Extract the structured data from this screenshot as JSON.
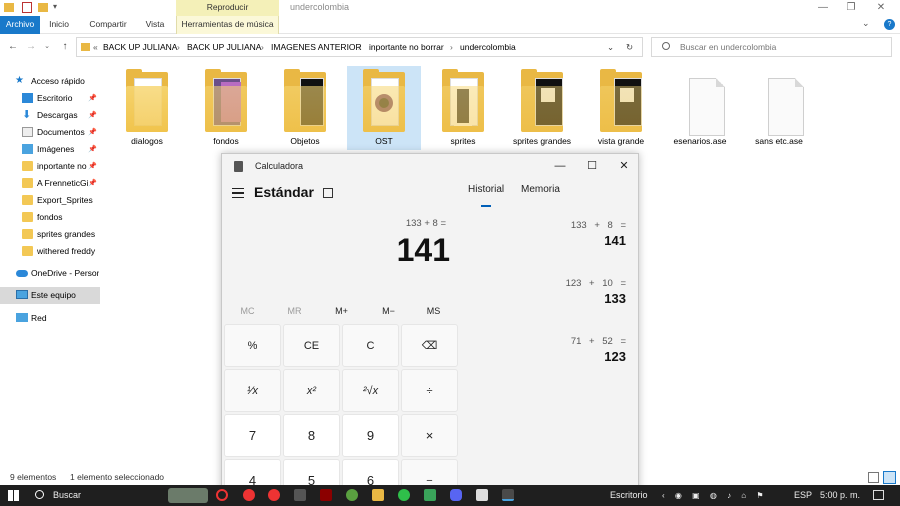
{
  "explorer": {
    "title": "undercolombia",
    "context_tab_header": "Reproducir",
    "ribbon_tabs": [
      "Archivo",
      "Inicio",
      "Compartir",
      "Vista",
      "Herramientas de música"
    ],
    "breadcrumb": [
      "BACK UP JULIANA",
      "BACK UP JULIANA",
      "IMAGENES ANTERIOR",
      "inportante no borrar",
      "undercolombia"
    ],
    "breadcrumb_prefix": "«",
    "search_placeholder": "Buscar en undercolombia",
    "sidebar": [
      {
        "label": "Acceso rápido",
        "icon": "star-icon"
      },
      {
        "label": "Escritorio",
        "icon": "desktop-folder-icon",
        "pinned": true
      },
      {
        "label": "Descargas",
        "icon": "download-folder-icon",
        "pinned": true
      },
      {
        "label": "Documentos",
        "icon": "documents-folder-icon",
        "pinned": true
      },
      {
        "label": "Imágenes",
        "icon": "pictures-folder-icon",
        "pinned": true
      },
      {
        "label": "inportante no",
        "icon": "folder-icon",
        "pinned": true
      },
      {
        "label": "A FrenneticGi",
        "icon": "folder-icon",
        "pinned": true
      },
      {
        "label": "Export_Sprites",
        "icon": "folder-icon"
      },
      {
        "label": "fondos",
        "icon": "folder-icon"
      },
      {
        "label": "sprites grandes",
        "icon": "folder-icon"
      },
      {
        "label": "withered freddy",
        "icon": "folder-icon"
      },
      {
        "label": "OneDrive - Person",
        "icon": "cloud-icon"
      },
      {
        "label": "Este equipo",
        "icon": "computer-icon",
        "selected": true
      },
      {
        "label": "Red",
        "icon": "network-icon"
      }
    ],
    "files": [
      {
        "label": "dialogos",
        "type": "folder",
        "preview": "blank"
      },
      {
        "label": "fondos",
        "type": "folder",
        "preview": "purple"
      },
      {
        "label": "Objetos",
        "type": "folder",
        "preview": "dark"
      },
      {
        "label": "OST",
        "type": "folder",
        "preview": "disc",
        "selected": true
      },
      {
        "label": "sprites",
        "type": "folder",
        "preview": "sprite"
      },
      {
        "label": "sprites grandes",
        "type": "folder",
        "preview": "bigsprite"
      },
      {
        "label": "vista grande",
        "type": "folder",
        "preview": "bigsprite"
      },
      {
        "label": "esenarios.ase",
        "type": "file"
      },
      {
        "label": "sans etc.ase",
        "type": "file"
      }
    ],
    "status": {
      "items": "9 elementos",
      "selected": "1 elemento seleccionado"
    }
  },
  "calculator": {
    "title": "Calculadora",
    "mode": "Estándar",
    "expression": "133 + 8 =",
    "result": "141",
    "memory_buttons": [
      {
        "label": "MC",
        "enabled": false
      },
      {
        "label": "MR",
        "enabled": false
      },
      {
        "label": "M+",
        "enabled": true
      },
      {
        "label": "M−",
        "enabled": true
      },
      {
        "label": "MS",
        "enabled": true
      }
    ],
    "keys": [
      [
        "%",
        "CE",
        "C",
        "⌫"
      ],
      [
        "¹⁄x",
        "x²",
        "²√x",
        "÷"
      ],
      [
        "7",
        "8",
        "9",
        "×"
      ],
      [
        "4",
        "5",
        "6",
        "−"
      ]
    ],
    "history_tabs": [
      "Historial",
      "Memoria"
    ],
    "history": [
      {
        "expression": "133   +   8   =",
        "result": "141"
      },
      {
        "expression": "123   +   10   =",
        "result": "133"
      },
      {
        "expression": "71   +   52   =",
        "result": "123"
      }
    ]
  },
  "taskbar": {
    "search_label": "Buscar",
    "desktop_label": "Escritorio",
    "language": "ESP",
    "time": "5:00 p. m."
  }
}
